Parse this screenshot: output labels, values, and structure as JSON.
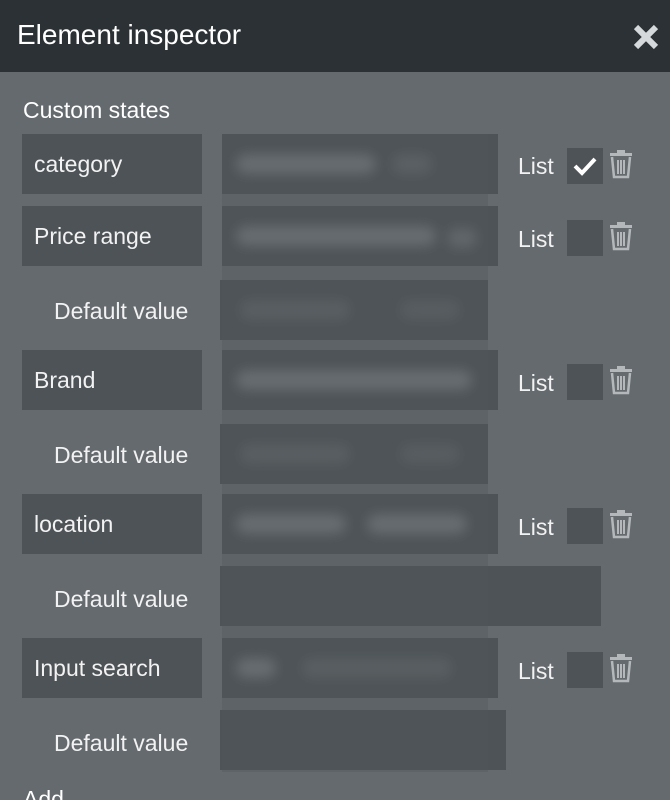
{
  "header": {
    "title": "Element inspector"
  },
  "section": {
    "title": "Custom states"
  },
  "states": [
    {
      "name": "category",
      "list_label": "List",
      "list_checked": true,
      "has_default": false
    },
    {
      "name": "Price range",
      "list_label": "List",
      "list_checked": false,
      "has_default": true,
      "default_label": "Default value"
    },
    {
      "name": "Brand",
      "list_label": "List",
      "list_checked": false,
      "has_default": true,
      "default_label": "Default value"
    },
    {
      "name": "location",
      "list_label": "List",
      "list_checked": false,
      "has_default": true,
      "default_label": "Default value"
    },
    {
      "name": "Input search",
      "list_label": "List",
      "list_checked": false,
      "has_default": true,
      "default_label": "Default value"
    }
  ],
  "footer": {
    "add_label": "Add"
  },
  "icons": {
    "close": "close-x-icon",
    "trash": "trash-icon",
    "check": "checkmark-icon"
  },
  "colors": {
    "header_bg": "#2b3134",
    "panel_bg": "#646a6e",
    "field_bg": "#4d5357",
    "text": "#f2f2f2"
  }
}
